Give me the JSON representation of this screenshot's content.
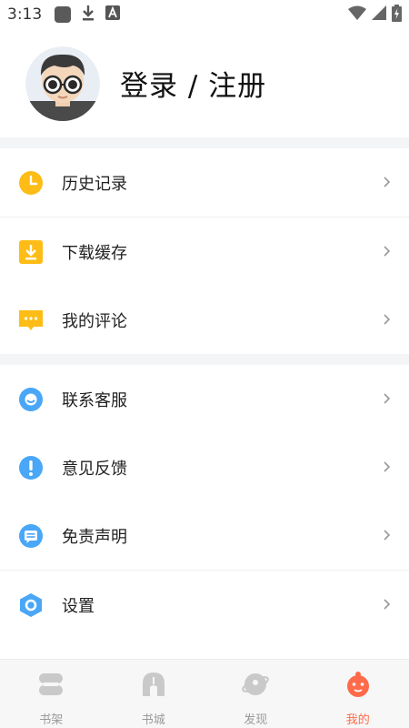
{
  "status_bar": {
    "time": "3:13",
    "icons": [
      "app-notification-icon",
      "download-icon",
      "a-icon",
      "wifi-icon",
      "signal-icon",
      "battery-charging-icon"
    ]
  },
  "profile": {
    "login_label": "登录 / 注册",
    "avatar_icon": "cartoon-avatar-icon"
  },
  "menu": {
    "items": [
      {
        "label": "历史记录",
        "icon": "clock-icon",
        "color": "#fdbd16"
      },
      {
        "label": "下载缓存",
        "icon": "download-box-icon",
        "color": "#fdbd16"
      },
      {
        "label": "我的评论",
        "icon": "comment-icon",
        "color": "#fdbd16"
      },
      {
        "label": "联系客服",
        "icon": "customer-service-icon",
        "color": "#4aa6f6"
      },
      {
        "label": "意见反馈",
        "icon": "exclamation-icon",
        "color": "#4aa6f6"
      },
      {
        "label": "免责声明",
        "icon": "message-icon",
        "color": "#4aa6f6"
      },
      {
        "label": "设置",
        "icon": "settings-hexagon-icon",
        "color": "#4aa6f6"
      }
    ]
  },
  "bottom_nav": {
    "items": [
      {
        "label": "书架",
        "icon": "bookshelf-icon"
      },
      {
        "label": "书城",
        "icon": "bookstore-icon"
      },
      {
        "label": "发现",
        "icon": "discover-icon"
      },
      {
        "label": "我的",
        "icon": "mine-icon"
      }
    ],
    "active_index": 3,
    "active_color": "#ff6b4a",
    "inactive_color": "#9a9a9a"
  }
}
